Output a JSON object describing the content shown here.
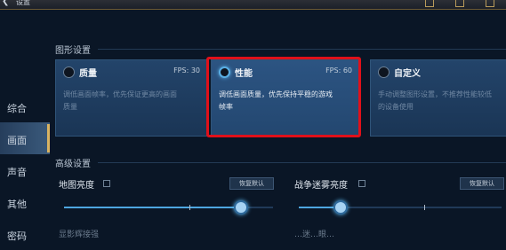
{
  "header": {
    "back_icon": "back-arrow-icon",
    "title": "设置"
  },
  "sidebar": {
    "items": [
      {
        "label": "综合"
      },
      {
        "label": "画面"
      },
      {
        "label": "声音"
      },
      {
        "label": "其他"
      },
      {
        "label": "密码"
      }
    ],
    "active_index": 1
  },
  "graphics": {
    "section_title": "图形设置",
    "options": [
      {
        "title": "质量",
        "fps": "FPS: 30",
        "desc_line1": "调低画面帧率，优先保证更高的画面",
        "desc_line2": "质量",
        "selected": false
      },
      {
        "title": "性能",
        "fps": "FPS: 60",
        "desc_line1": "调低画面质量，优先保持平稳的游戏",
        "desc_line2": "帧率",
        "selected": true
      },
      {
        "title": "自定义",
        "fps": "",
        "desc_line1": "手动调整图形设置，不推荐性能较低",
        "desc_line2": "的设备使用",
        "selected": false
      }
    ]
  },
  "advanced": {
    "section_title": "高级设置",
    "settings": [
      {
        "label": "地图亮度",
        "reset_label": "恢复默认",
        "value": 0.95
      },
      {
        "label": "战争迷雾亮度",
        "reset_label": "恢复默认",
        "value": 0.25
      }
    ],
    "partial_labels": [
      "显影辉接强",
      "…迷…眼…"
    ]
  },
  "colors": {
    "accent_gold": "#d9b463",
    "accent_blue": "#4ea6e0",
    "highlight_red": "#e0101a"
  }
}
